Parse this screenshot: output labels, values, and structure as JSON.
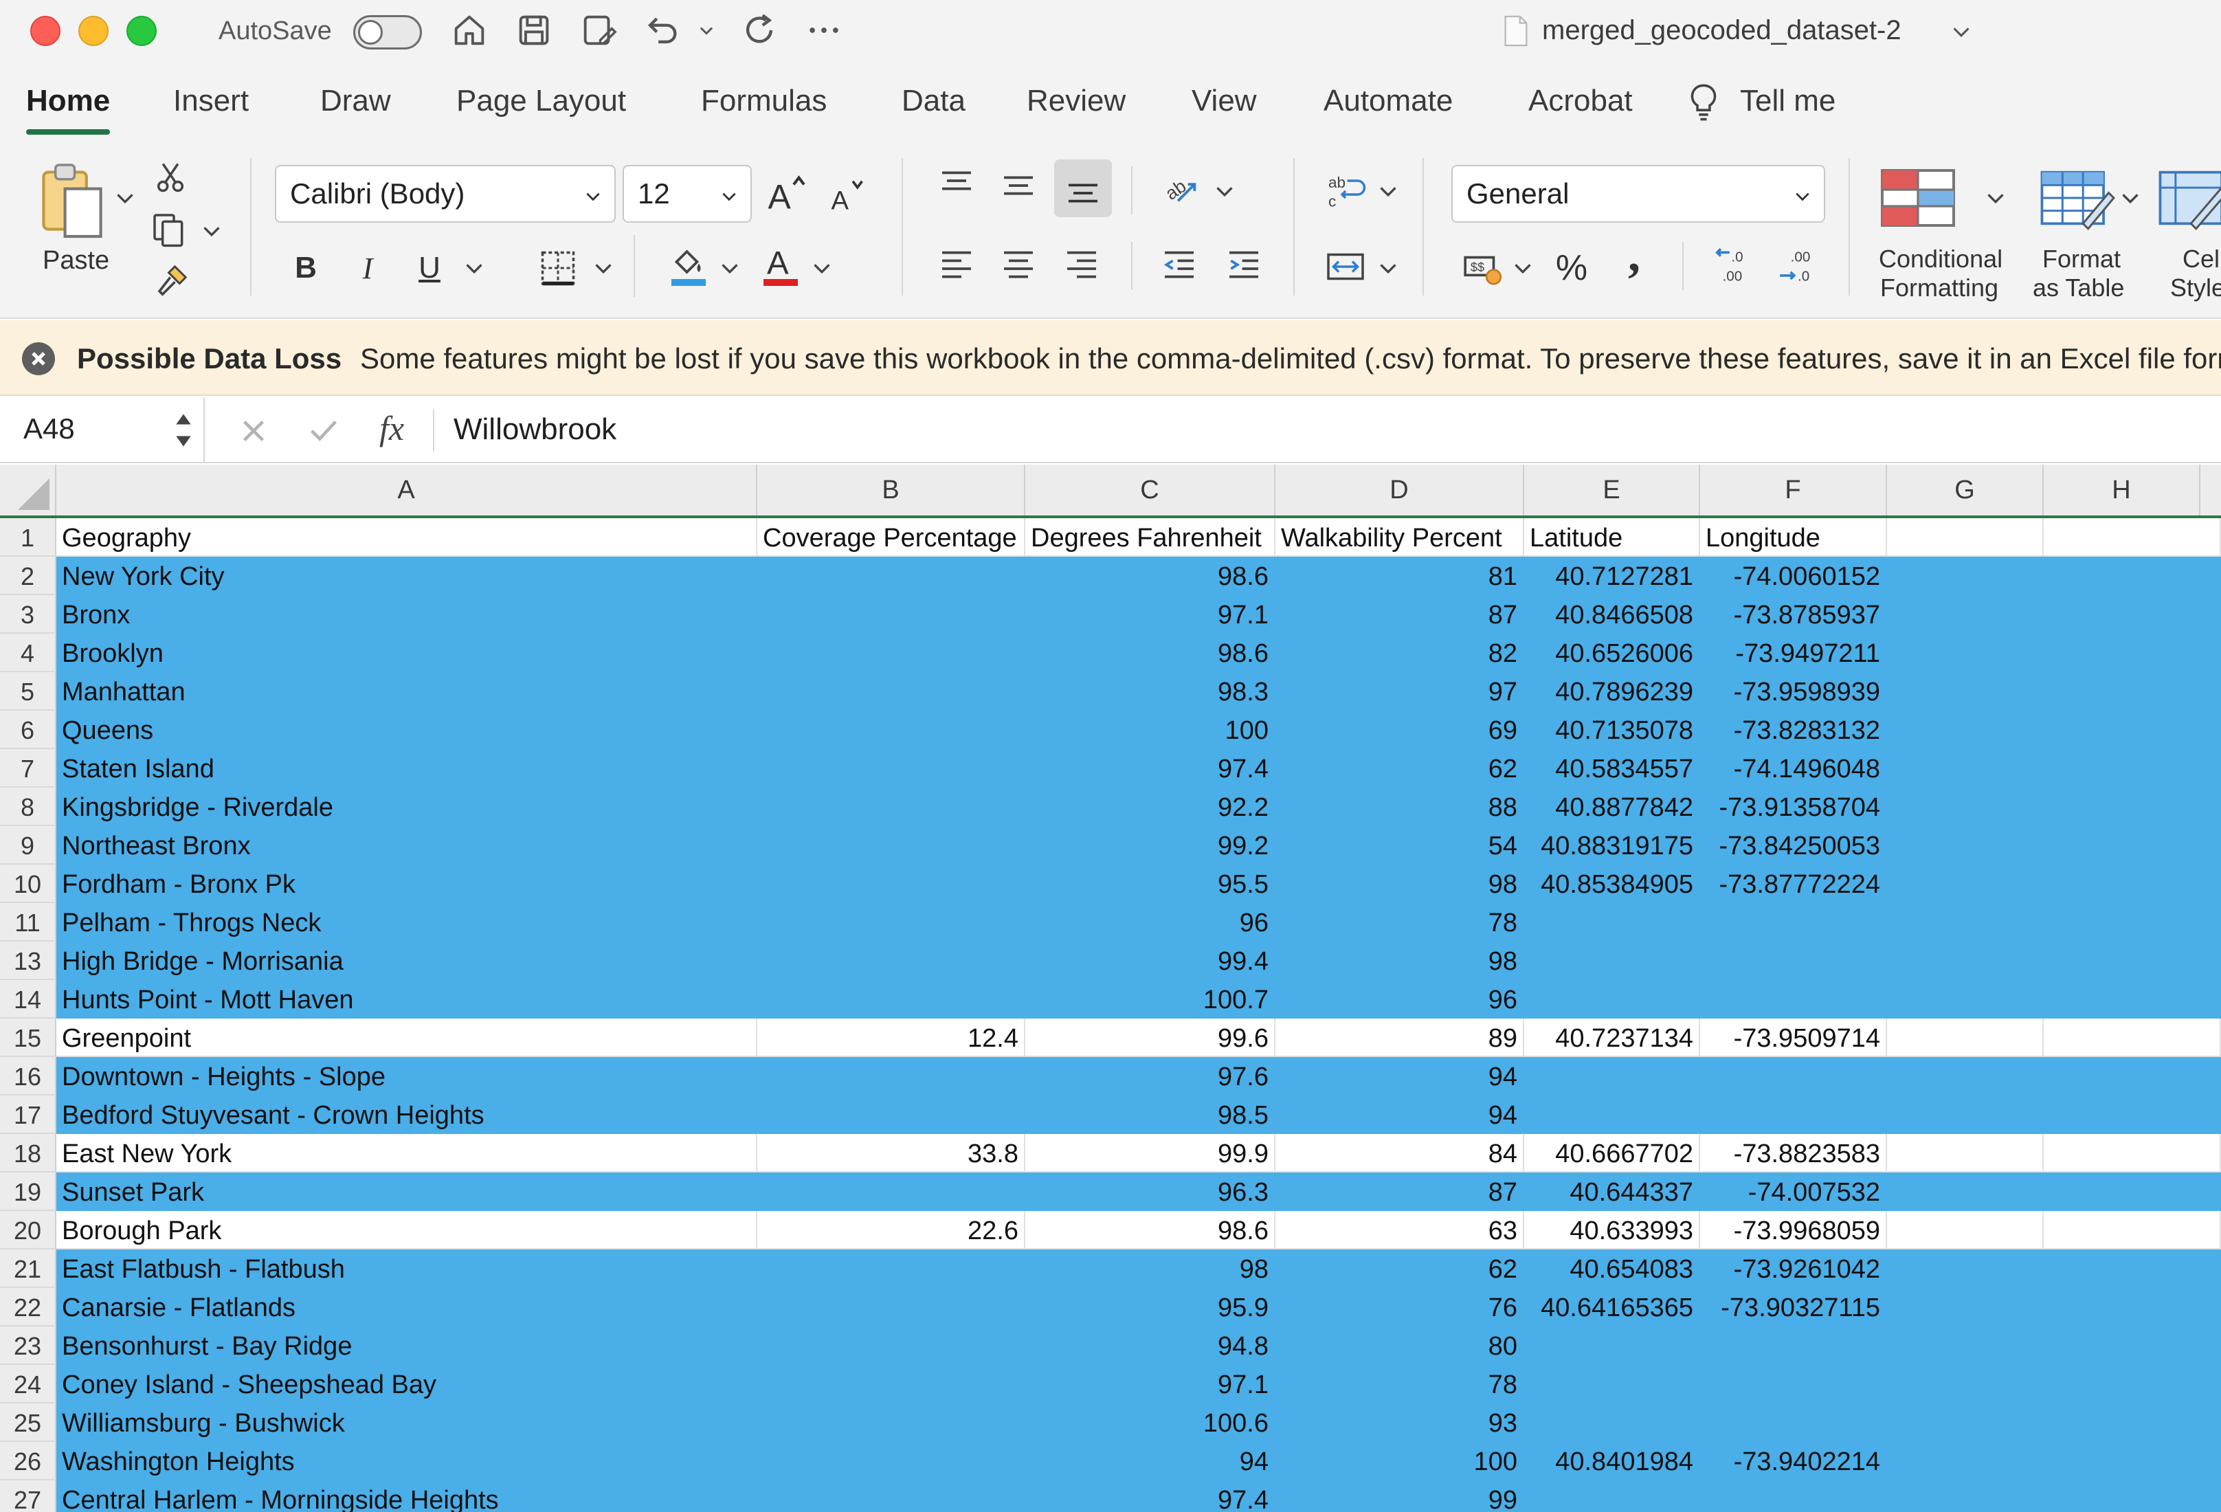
{
  "window": {
    "autosave_label": "AutoSave",
    "document_title": "merged_geocoded_dataset-2"
  },
  "tabs": [
    "Home",
    "Insert",
    "Draw",
    "Page Layout",
    "Formulas",
    "Data",
    "Review",
    "View",
    "Automate",
    "Acrobat",
    "Tell me"
  ],
  "ribbon": {
    "paste_label": "Paste",
    "font_name": "Calibri (Body)",
    "font_size": "12",
    "number_format": "General",
    "conditional_formatting_line1": "Conditional",
    "conditional_formatting_line2": "Formatting",
    "format_as_table_line1": "Format",
    "format_as_table_line2": "as Table",
    "cell_styles_line1": "Cell",
    "cell_styles_line2": "Styles",
    "bold_label": "B",
    "italic_label": "I",
    "underline_label": "U",
    "percent_label": "%",
    "comma_label": ",",
    "font_color": "#e02020",
    "fill_color": "#2f9be6"
  },
  "infobar": {
    "title": "Possible Data Loss",
    "message": "Some features might be lost if you save this workbook in the comma-delimited (.csv) format. To preserve these features, save it in an Excel file format."
  },
  "formula_bar": {
    "name_box": "A48",
    "fx_label": "fx",
    "value": "Willowbrook"
  },
  "columns": [
    "A",
    "B",
    "C",
    "D",
    "E",
    "F",
    "G",
    "H"
  ],
  "header_row": {
    "row_number": "1",
    "cells": [
      "Geography",
      "Coverage Percentage",
      "Degrees Fahrenheit",
      "Walkability Percent",
      "Latitude",
      "Longitude",
      "",
      ""
    ]
  },
  "rows": [
    {
      "n": "2",
      "sel": true,
      "cells": [
        "New York City",
        "",
        "98.6",
        "81",
        "40.7127281",
        "-74.0060152"
      ]
    },
    {
      "n": "3",
      "sel": true,
      "cells": [
        "Bronx",
        "",
        "97.1",
        "87",
        "40.8466508",
        "-73.8785937"
      ]
    },
    {
      "n": "4",
      "sel": true,
      "cells": [
        "Brooklyn",
        "",
        "98.6",
        "82",
        "40.6526006",
        "-73.9497211"
      ]
    },
    {
      "n": "5",
      "sel": true,
      "cells": [
        "Manhattan",
        "",
        "98.3",
        "97",
        "40.7896239",
        "-73.9598939"
      ]
    },
    {
      "n": "6",
      "sel": true,
      "cells": [
        "Queens",
        "",
        "100",
        "69",
        "40.7135078",
        "-73.8283132"
      ]
    },
    {
      "n": "7",
      "sel": true,
      "cells": [
        "Staten Island",
        "",
        "97.4",
        "62",
        "40.5834557",
        "-74.1496048"
      ]
    },
    {
      "n": "8",
      "sel": true,
      "cells": [
        "Kingsbridge - Riverdale",
        "",
        "92.2",
        "88",
        "40.8877842",
        "-73.91358704"
      ]
    },
    {
      "n": "9",
      "sel": true,
      "cells": [
        "Northeast Bronx",
        "",
        "99.2",
        "54",
        "40.88319175",
        "-73.84250053"
      ]
    },
    {
      "n": "10",
      "sel": true,
      "cells": [
        "Fordham - Bronx Pk",
        "",
        "95.5",
        "98",
        "40.85384905",
        "-73.87772224"
      ]
    },
    {
      "n": "11",
      "sel": true,
      "cells": [
        "Pelham - Throgs Neck",
        "",
        "96",
        "78",
        "",
        ""
      ]
    },
    {
      "n": "13",
      "sel": true,
      "cells": [
        "High Bridge - Morrisania",
        "",
        "99.4",
        "98",
        "",
        ""
      ]
    },
    {
      "n": "14",
      "sel": true,
      "cells": [
        "Hunts Point - Mott Haven",
        "",
        "100.7",
        "96",
        "",
        ""
      ]
    },
    {
      "n": "15",
      "sel": false,
      "cells": [
        "Greenpoint",
        "12.4",
        "99.6",
        "89",
        "40.7237134",
        "-73.9509714"
      ]
    },
    {
      "n": "16",
      "sel": true,
      "cells": [
        "Downtown - Heights - Slope",
        "",
        "97.6",
        "94",
        "",
        ""
      ]
    },
    {
      "n": "17",
      "sel": true,
      "cells": [
        "Bedford Stuyvesant - Crown Heights",
        "",
        "98.5",
        "94",
        "",
        ""
      ]
    },
    {
      "n": "18",
      "sel": false,
      "cells": [
        "East New York",
        "33.8",
        "99.9",
        "84",
        "40.6667702",
        "-73.8823583"
      ]
    },
    {
      "n": "19",
      "sel": true,
      "cells": [
        "Sunset Park",
        "",
        "96.3",
        "87",
        "40.644337",
        "-74.007532"
      ]
    },
    {
      "n": "20",
      "sel": false,
      "cells": [
        "Borough Park",
        "22.6",
        "98.6",
        "63",
        "40.633993",
        "-73.9968059"
      ]
    },
    {
      "n": "21",
      "sel": true,
      "cells": [
        "East Flatbush - Flatbush",
        "",
        "98",
        "62",
        "40.654083",
        "-73.9261042"
      ]
    },
    {
      "n": "22",
      "sel": true,
      "cells": [
        "Canarsie - Flatlands",
        "",
        "95.9",
        "76",
        "40.64165365",
        "-73.90327115"
      ]
    },
    {
      "n": "23",
      "sel": true,
      "cells": [
        "Bensonhurst - Bay Ridge",
        "",
        "94.8",
        "80",
        "",
        ""
      ]
    },
    {
      "n": "24",
      "sel": true,
      "cells": [
        "Coney Island - Sheepshead Bay",
        "",
        "97.1",
        "78",
        "",
        ""
      ]
    },
    {
      "n": "25",
      "sel": true,
      "cells": [
        "Williamsburg - Bushwick",
        "",
        "100.6",
        "93",
        "",
        ""
      ]
    },
    {
      "n": "26",
      "sel": true,
      "cells": [
        "Washington Heights",
        "",
        "94",
        "100",
        "40.8401984",
        "-73.9402214"
      ]
    },
    {
      "n": "27",
      "sel": true,
      "cells": [
        "Central Harlem - Morningside Heights",
        "",
        "97.4",
        "99",
        "",
        ""
      ]
    }
  ],
  "colors": {
    "selection": "#4aaee8",
    "accent": "#217346"
  }
}
